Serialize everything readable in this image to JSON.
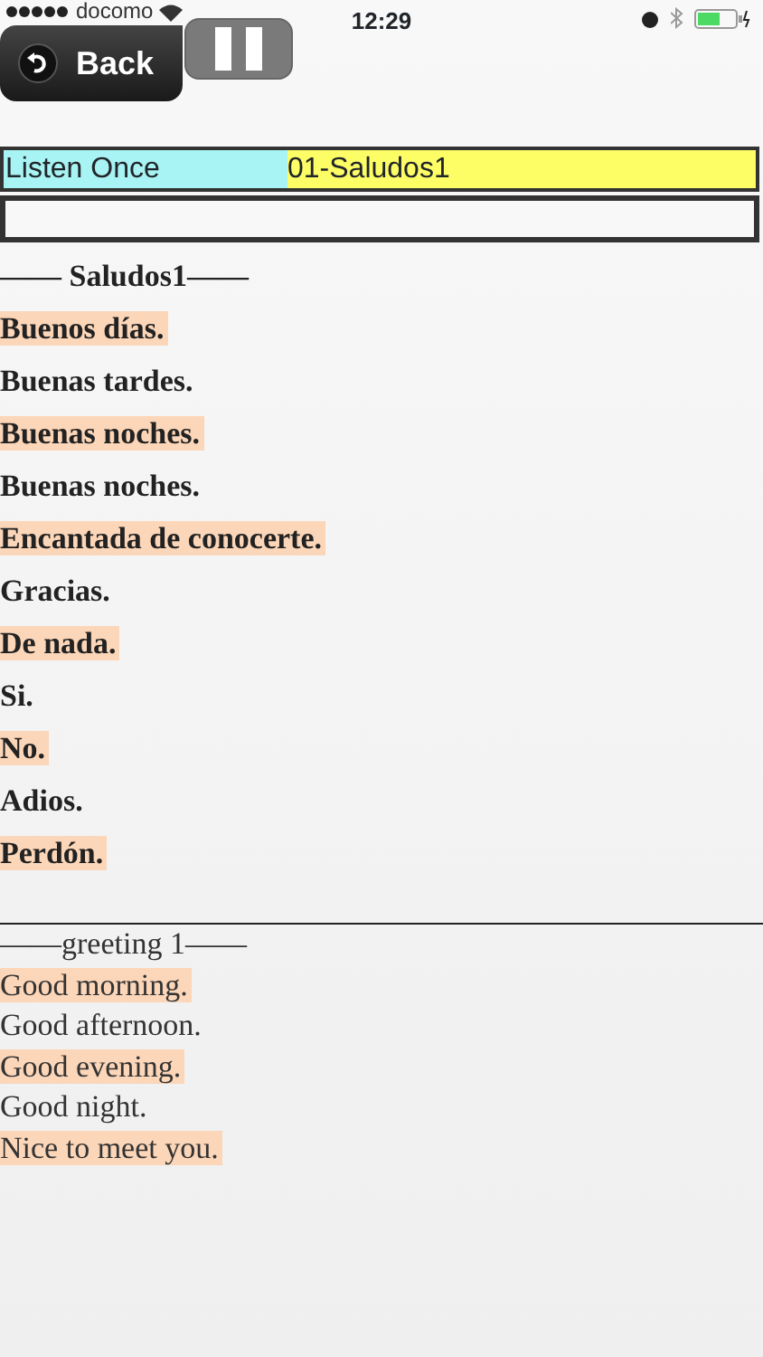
{
  "status_bar": {
    "carrier": "docomo",
    "time": "12:29"
  },
  "toolbar": {
    "back_label": "Back"
  },
  "info_bar": {
    "mode": "Listen Once",
    "track": "01-Saludos1"
  },
  "spanish": {
    "heading": "—— Saludos1——",
    "lines": [
      {
        "text": "Buenos días.",
        "highlighted": true
      },
      {
        "text": "Buenas tardes.",
        "highlighted": false
      },
      {
        "text": "Buenas noches.",
        "highlighted": true
      },
      {
        "text": "Buenas noches.",
        "highlighted": false
      },
      {
        "text": "Encantada de conocerte.",
        "highlighted": true
      },
      {
        "text": "Gracias.",
        "highlighted": false
      },
      {
        "text": "De nada.",
        "highlighted": true
      },
      {
        "text": "Si.",
        "highlighted": false
      },
      {
        "text": "No.",
        "highlighted": true
      },
      {
        "text": "Adios.",
        "highlighted": false
      },
      {
        "text": "Perdón.",
        "highlighted": true
      }
    ]
  },
  "english": {
    "heading": "——greeting 1——",
    "lines": [
      {
        "text": "Good morning.",
        "highlighted": true
      },
      {
        "text": "Good afternoon.",
        "highlighted": false
      },
      {
        "text": "Good evening.",
        "highlighted": true
      },
      {
        "text": "Good night.",
        "highlighted": false
      },
      {
        "text": "Nice to meet you.",
        "highlighted": true
      }
    ]
  }
}
